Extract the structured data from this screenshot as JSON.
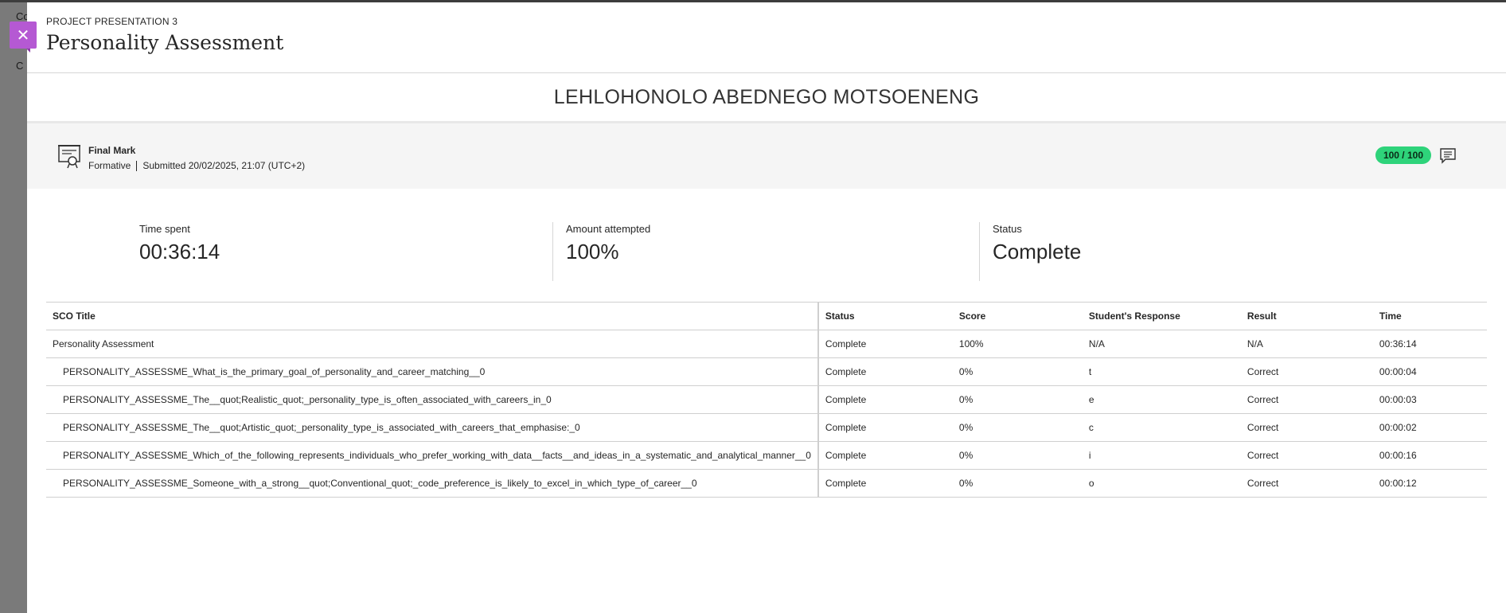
{
  "backdrop": {
    "peek_1": "Co",
    "peek_2": "C"
  },
  "header": {
    "breadcrumb": "PROJECT PRESENTATION 3",
    "title": "Personality Assessment"
  },
  "student": {
    "name": "LEHLOHONOLO ABEDNEGO MOTSOENENG"
  },
  "grade": {
    "label": "Final Mark",
    "type": "Formative",
    "submitted": "Submitted 20/02/2025, 21:07 (UTC+2)",
    "score": "100 / 100",
    "pill_color": "#2ed37a"
  },
  "stats": {
    "time_spent_label": "Time spent",
    "time_spent_value": "00:36:14",
    "attempted_label": "Amount attempted",
    "attempted_value": "100%",
    "status_label": "Status",
    "status_value": "Complete"
  },
  "table": {
    "headers": [
      "SCO Title",
      "Status",
      "Score",
      "Student's Response",
      "Result",
      "Time"
    ],
    "rows": [
      [
        "Personality Assessment",
        "Complete",
        "100%",
        "N/A",
        "N/A",
        "00:36:14"
      ],
      [
        "PERSONALITY_ASSESSME_What_is_the_primary_goal_of_personality_and_career_matching__0",
        "Complete",
        "0%",
        "t",
        "Correct",
        "00:00:04"
      ],
      [
        "PERSONALITY_ASSESSME_The__quot;Realistic_quot;_personality_type_is_often_associated_with_careers_in_0",
        "Complete",
        "0%",
        "e",
        "Correct",
        "00:00:03"
      ],
      [
        "PERSONALITY_ASSESSME_The__quot;Artistic_quot;_personality_type_is_associated_with_careers_that_emphasise:_0",
        "Complete",
        "0%",
        "c",
        "Correct",
        "00:00:02"
      ],
      [
        "PERSONALITY_ASSESSME_Which_of_the_following_represents_individuals_who_prefer_working_with_data__facts__and_ideas_in_a_systematic_and_analytical_manner__0",
        "Complete",
        "0%",
        "i",
        "Correct",
        "00:00:16"
      ],
      [
        "PERSONALITY_ASSESSME_Someone_with_a_strong__quot;Conventional_quot;_code_preference_is_likely_to_excel_in_which_type_of_career__0",
        "Complete",
        "0%",
        "o",
        "Correct",
        "00:00:12"
      ]
    ]
  },
  "icons": {
    "close": "close-icon",
    "grade": "certificate-icon",
    "feedback": "comment-icon"
  }
}
